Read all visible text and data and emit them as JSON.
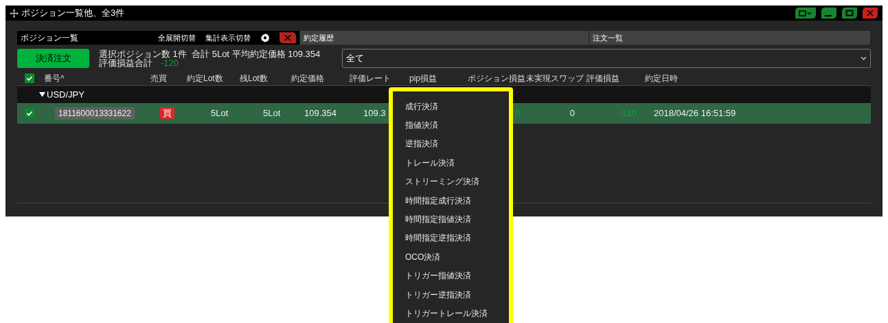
{
  "window": {
    "title": "ポジション一覧他、全3件"
  },
  "tabs": [
    {
      "label": "ポジション一覧",
      "selected": true,
      "actions": [
        "全展開切替",
        "集計表示切替"
      ]
    },
    {
      "label": "約定履歴",
      "selected": false
    },
    {
      "label": "注文一覧",
      "selected": false
    }
  ],
  "toolbar": {
    "settle_button": "決済注文",
    "summary": "選択ポジション数 1件  合計 5Lot 平均約定価格 109.354",
    "pl_label": "評価損益合計",
    "pl_value": "-120",
    "filter": {
      "value": "全て"
    }
  },
  "table": {
    "all_checked": true,
    "columns": [
      "番号^",
      "売買",
      "約定Lot数",
      "残Lot数",
      "約定価格",
      "評価レート",
      "pip損益",
      "ポジション損益",
      "未実現スワップ",
      "評価損益",
      "約定日時"
    ],
    "groups": [
      {
        "label": "USD/JPY",
        "expanded": true,
        "rows": [
          {
            "checked": true,
            "selected": true,
            "number": "1811600013331622",
            "side": "買",
            "lot": "5Lot",
            "remaining": "5Lot",
            "price": "109.354",
            "rate": "109.3",
            "position_pl": "0",
            "swap": "0",
            "pl": "-120",
            "time": "2018/04/26 16:51:59"
          }
        ]
      }
    ]
  },
  "context_menu": {
    "items": [
      "成行決済",
      "指値決済",
      "逆指決済",
      "トレール決済",
      "ストリーミング決済",
      "時間指定成行決済",
      "時間指定指値決済",
      "時間指定逆指決済",
      "OCO決済",
      "トリガー指値決済",
      "トリガー逆指決済",
      "トリガートレール決済"
    ]
  }
}
